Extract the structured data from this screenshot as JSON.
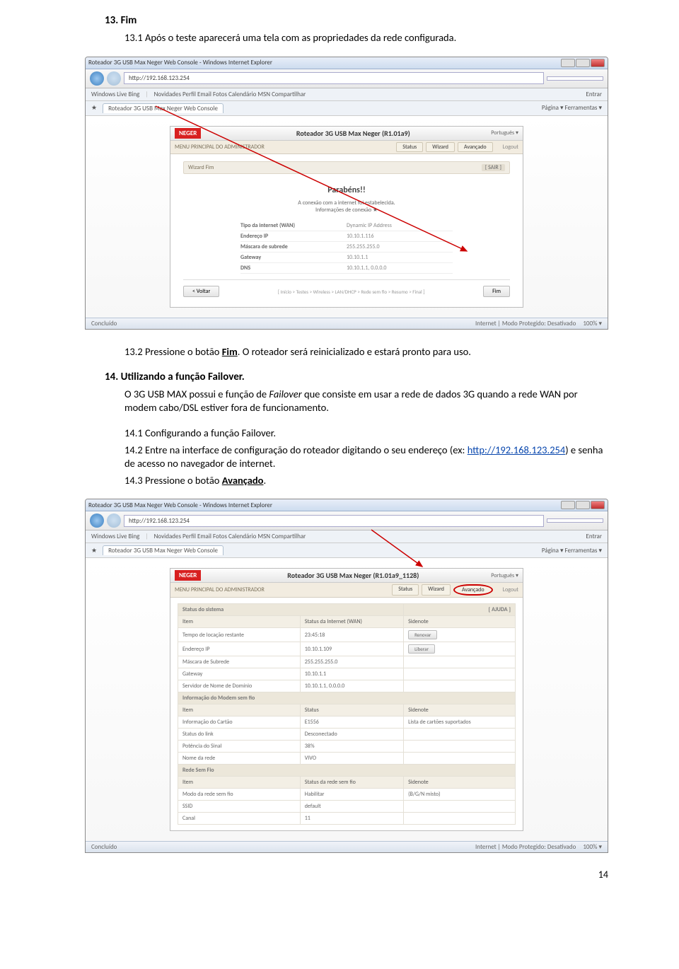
{
  "section13": {
    "heading": "13. Fim",
    "p1_prefix": "13.1 Após o teste aparecerá uma tela com as propriedades da rede configurada.",
    "p2_prefix": "13.2 Pressione o botão ",
    "p2_bold": "Fim",
    "p2_suffix": ". O roteador será reinicializado e estará pronto para uso."
  },
  "section14": {
    "heading": "14. Utilizando a função Failover.",
    "p1_a": "O 3G USB MAX possui e função de ",
    "p1_it": "Failover",
    "p1_b": " que consiste em usar a rede de dados 3G quando a rede WAN por modem cabo/DSL estiver fora de funcionamento.",
    "p2": "14.1 Configurando a função Failover.",
    "p3_a": "14.2 Entre na interface de configuração do roteador digitando o seu endereço (ex: ",
    "p3_link": "http://192.168.123.254",
    "p3_b": ") e senha de acesso no navegador de internet.",
    "p4_a": "14.3 Pressione o botão ",
    "p4_bold": "Avançado",
    "p4_b": "."
  },
  "browser": {
    "title": "Roteador 3G USB Max Neger Web Console - Windows Internet Explorer",
    "url": "http://192.168.123.254",
    "fav_label": "Windows Live  Bing",
    "menu": "Novidades  Perfil  Email  Fotos  Calendário  MSN  Compartilhar",
    "tab": "Roteador 3G USB Max Neger Web Console",
    "tools": "Página ▾  Ferramentas ▾",
    "snap": "Entrar",
    "status_done": "Concluído",
    "status_mode": "Internet | Modo Protegido: Desativado",
    "zoom": "100% ▾"
  },
  "router1": {
    "logo": "NEGER",
    "title": "Roteador 3G USB Max Neger (R1.01a9)",
    "lang": "Português ▾",
    "crumb": "MENU PRINCIPAL DO ADMINISTRADOR",
    "tabs": [
      "Status",
      "Wizard",
      "Avançado"
    ],
    "logout": "Logout",
    "section_label": "Wizard  Fim",
    "section_badge": "[ SAIR ]",
    "congrats_h": "Parabéns!!",
    "congrats_s1": "A conexão com a internet foi estabelecida.",
    "congrats_s2": "Informações de conexão ★",
    "rows": [
      {
        "k": "Tipo da internet (WAN)",
        "v": "Dynamic IP Address"
      },
      {
        "k": "Endereço IP",
        "v": "10.10.1.116"
      },
      {
        "k": "Máscara de subrede",
        "v": "255.255.255.0"
      },
      {
        "k": "Gateway",
        "v": "10.10.1.1"
      },
      {
        "k": "DNS",
        "v": "10.10.1.1, 0.0.0.0"
      }
    ],
    "back_btn": "< Voltar",
    "foot_crumbs": "[ Início > Testes > Wireless > LAN/DHCP > Rede sem fio > Resumo > Final ]",
    "fim_btn": "Fim"
  },
  "router2": {
    "logo": "NEGER",
    "title": "Roteador 3G USB Max Neger (R1.01a9_1128)",
    "lang": "Português ▾",
    "crumb": "MENU PRINCIPAL DO ADMINISTRADOR",
    "tabs": [
      "Status",
      "Wizard",
      "Avançado"
    ],
    "logout": "Logout",
    "sec1": "Status do sistema",
    "sec1_badge": "[ AJUDA ]",
    "head": [
      "Item",
      "Status da Internet (WAN)",
      "Sidenote"
    ],
    "rows1": [
      {
        "k": "Tempo de locação restante",
        "v": "23:45:18",
        "a": "Renovar"
      },
      {
        "k": "Endereço IP",
        "v": "10.10.1.109",
        "a": "Liberar"
      },
      {
        "k": "Máscara de Subrede",
        "v": "255.255.255.0",
        "a": ""
      },
      {
        "k": "Gateway",
        "v": "10.10.1.1",
        "a": ""
      },
      {
        "k": "Servidor de Nome de Domínio",
        "v": "10.10.1.1, 0.0.0.0",
        "a": ""
      }
    ],
    "sec2": "Informação do Modem sem fio",
    "head2": [
      "Item",
      "Status",
      "Sidenote"
    ],
    "rows2": [
      {
        "k": "Informação do Cartão",
        "v": "E1556",
        "a": "Lista de cartões suportados"
      },
      {
        "k": "Status do link",
        "v": "Desconectado",
        "a": ""
      },
      {
        "k": "Potência do Sinal",
        "v": "38%",
        "a": ""
      },
      {
        "k": "Nome da rede",
        "v": "VIVO",
        "a": ""
      }
    ],
    "sec3": "Rede Sem Fio",
    "head3": [
      "Item",
      "Status da rede sem fio",
      "Sidenote"
    ],
    "rows3": [
      {
        "k": "Modo da rede sem fio",
        "v": "Habilitar",
        "a": "(B/G/N misto)"
      },
      {
        "k": "SSID",
        "v": "default",
        "a": ""
      },
      {
        "k": "Canal",
        "v": "11",
        "a": ""
      }
    ]
  },
  "page_num": "14"
}
